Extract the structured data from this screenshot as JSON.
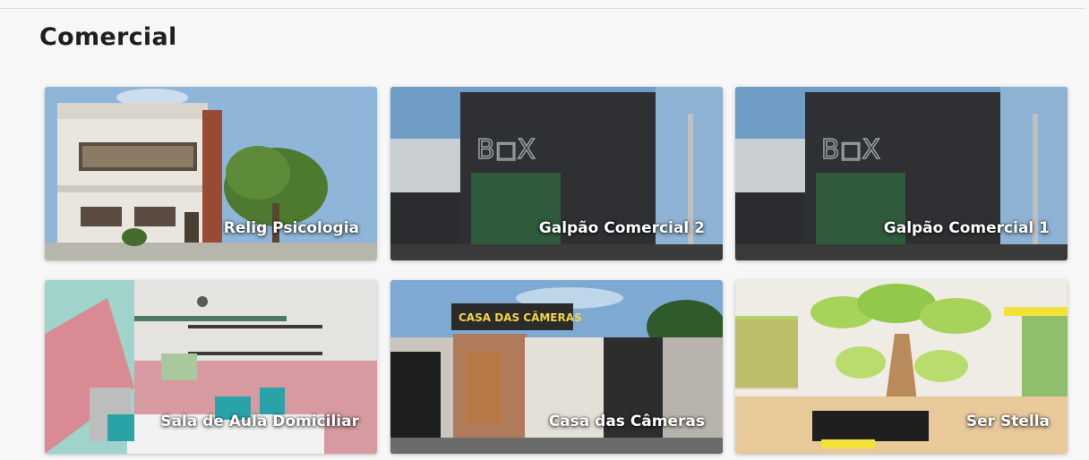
{
  "section": {
    "title": "Comercial"
  },
  "projects": [
    {
      "label": "Relig Psicologia"
    },
    {
      "label": "Galpão Comercial 2",
      "sign": "B◻X"
    },
    {
      "label": "Galpão Comercial 1",
      "sign": "B◻X"
    },
    {
      "label": "Sala de Aula Domiciliar"
    },
    {
      "label": "Casa das Câmeras",
      "sign": "CASA DAS CÂMERAS"
    },
    {
      "label": "Ser Stella"
    }
  ]
}
